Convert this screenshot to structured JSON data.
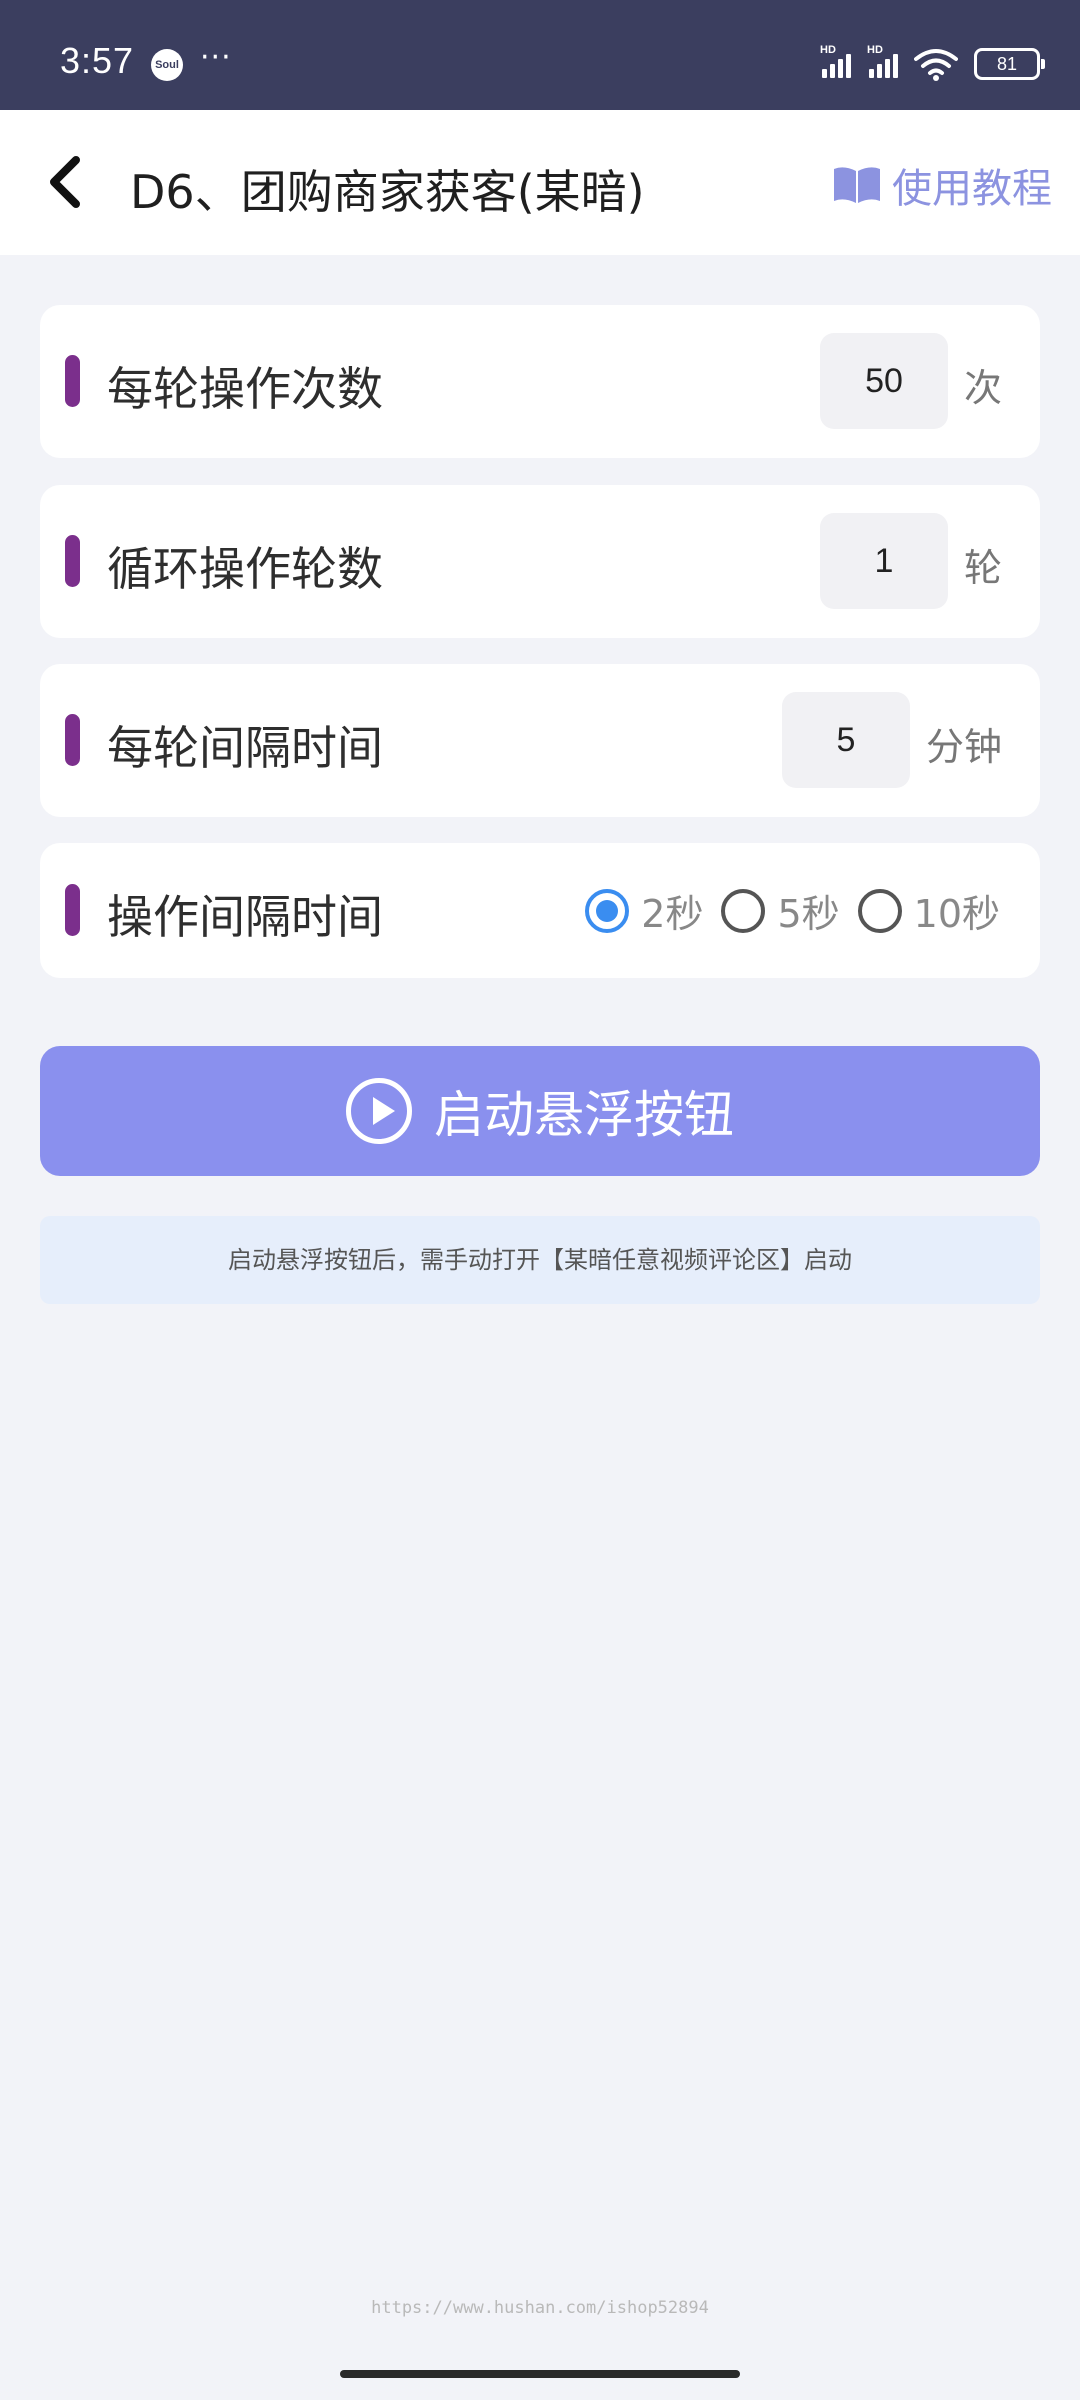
{
  "status_bar": {
    "time": "3:57",
    "app_badge": "Soul",
    "more": "···",
    "signal1_label": "HD",
    "signal2_label": "HD",
    "battery": "81"
  },
  "nav": {
    "title": "D6、团购商家获客(某暗)",
    "tutorial_label": "使用教程",
    "icons": {
      "back": "chevron-left-icon",
      "tutorial": "book-icon"
    },
    "accent_color": "#8c93e0"
  },
  "settings": {
    "per_round_ops": {
      "label": "每轮操作次数",
      "value": "50",
      "unit": "次"
    },
    "loop_rounds": {
      "label": "循环操作轮数",
      "value": "1",
      "unit": "轮"
    },
    "round_interval": {
      "label": "每轮间隔时间",
      "value": "5",
      "unit": "分钟"
    },
    "op_interval": {
      "label": "操作间隔时间",
      "options": [
        "2秒",
        "5秒",
        "10秒"
      ],
      "selected": "2秒"
    },
    "accent_bar_color": "#7b2f8c"
  },
  "start_button": {
    "label": "启动悬浮按钮",
    "icon": "play-circle-icon",
    "color": "#8a90ee"
  },
  "notice": {
    "text": "启动悬浮按钮后，需手动打开【某暗任意视频评论区】启动"
  },
  "watermark": "https://www.hushan.com/ishop52894"
}
